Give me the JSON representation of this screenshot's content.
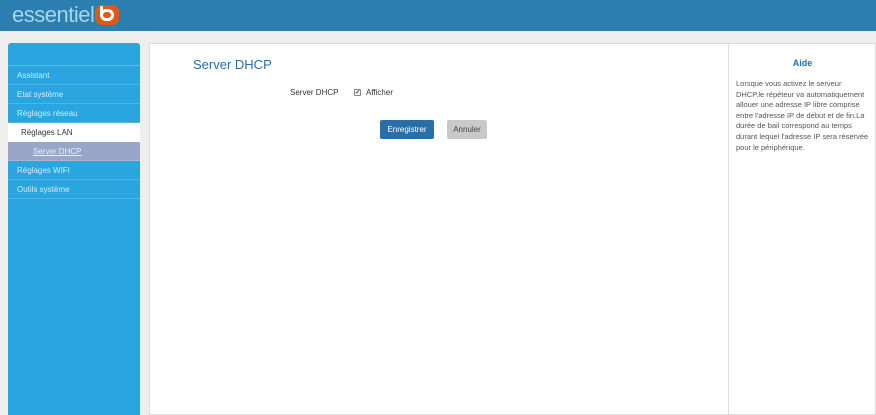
{
  "header": {
    "logo_text": "essentiel",
    "logo_badge": "b"
  },
  "sidebar": {
    "items": [
      {
        "label": "Assistant"
      },
      {
        "label": "Etat système"
      },
      {
        "label": "Réglages réseau"
      },
      {
        "label": "Réglages LAN"
      },
      {
        "label": "Server DHCP"
      },
      {
        "label": "Réglages WIFI"
      },
      {
        "label": "Outils système"
      }
    ]
  },
  "main": {
    "title": "Server DHCP",
    "field_label": "Server DHCP",
    "checkbox_checked": true,
    "checkbox_label": "Afficher",
    "save_label": "Enregistrer",
    "cancel_label": "Annuler"
  },
  "help": {
    "title": "Aide",
    "text": "Lorsque vous activez le serveur DHCP,le répéteur va automatiquement allouer une adresse IP libre comprise entre l'adresse IP de début et de fin.La durée de bail correspond au temps durant lequel l'adresse IP sera réservée pour le périphérique."
  },
  "colors": {
    "header": "#2a7fb0",
    "sidebar": "#2aa5e0",
    "accent": "#2a6ea8",
    "active_item": "#9aa6c8",
    "logo_badge": "#e0571a"
  }
}
